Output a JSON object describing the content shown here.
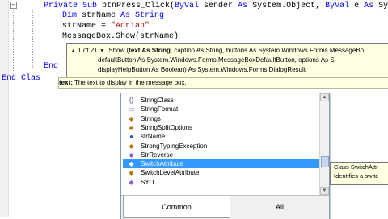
{
  "code": {
    "line1_kw1": "Private Sub ",
    "line1_rest": "btnPress_Click(",
    "line1_kw2": "ByVal",
    "line1_rest2": " sender ",
    "line1_kw3": "As",
    "line1_rest3": " System.Object, ",
    "line1_kw4": "ByVal",
    "line1_rest4": " e ",
    "line1_kw5": "As",
    "line1_rest5": " Sy",
    "line2_kw1": "Dim",
    "line2_mid": " strName ",
    "line2_kw2": "As String",
    "line3_pre": "strName = ",
    "line3_str": "\"Adrian\"",
    "line4": "MessageBox.Show(strName)",
    "line5": "End",
    "line6": "End Clas"
  },
  "signature": {
    "counter": "1 of 21",
    "line1_pre": "Show (",
    "line1_bold": "text As String",
    "line1_post": ", caption As String, buttons As System.Windows.Forms.MessageBo",
    "line2": "defaultButton As System.Windows.Forms.MessageBoxDefaultButton, options As S",
    "line3": "displayHelpButton As Boolean) As System.Windows.Forms.DialogResult"
  },
  "param_hint": {
    "label": "text:",
    "text": " The text to display in the message box."
  },
  "completion": {
    "items": [
      {
        "icon": "{}",
        "label": "StringClass"
      },
      {
        "icon": "▭",
        "label": "StringFormat"
      },
      {
        "icon": "◆",
        "label": "Strings"
      },
      {
        "icon": "▰",
        "label": "StringSplitOptions"
      },
      {
        "icon": "●",
        "label": "strName"
      },
      {
        "icon": "◆",
        "label": "StrongTypingException"
      },
      {
        "icon": "◆",
        "label": "StrReverse"
      },
      {
        "icon": "◆",
        "label": "SwitchAttribute",
        "selected": true
      },
      {
        "icon": "◆",
        "label": "SwitchLevelAttribute"
      },
      {
        "icon": "◆",
        "label": "SYD"
      }
    ],
    "tab_common": "Common",
    "tab_all": "All"
  },
  "class_tip": {
    "line1": "Class SwitchAttr",
    "line2": "Identifies a switc"
  },
  "colors": {
    "keyword": "#0000ff",
    "string": "#a31515",
    "selection": "#3399ff",
    "tooltip_bg": "#ffffe1"
  }
}
